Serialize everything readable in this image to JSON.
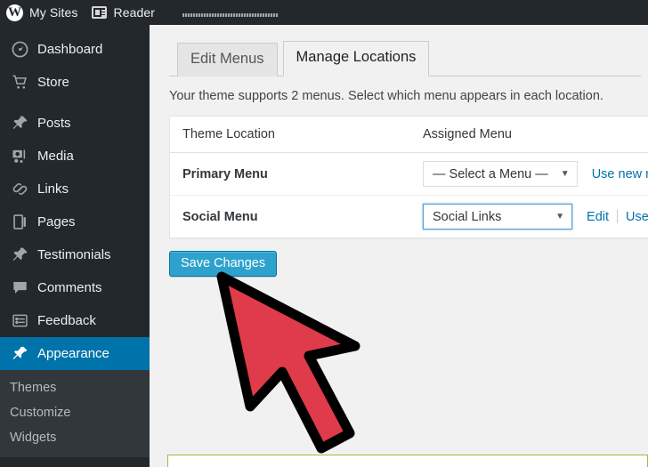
{
  "adminbar": {
    "logo_icon": "wordpress-logo-icon",
    "items": [
      {
        "icon": "wordpress-logo-icon",
        "label": "My Sites"
      },
      {
        "icon": "reader-icon",
        "label": "Reader"
      }
    ],
    "redacted_icon": "redacted-bar"
  },
  "sidebar": {
    "items": [
      {
        "label": "Dashboard",
        "icon": "dashboard-icon",
        "current": false
      },
      {
        "label": "Store",
        "icon": "cart-icon",
        "current": false
      },
      {
        "label": "Posts",
        "icon": "pin-icon",
        "current": false
      },
      {
        "label": "Media",
        "icon": "camera-icon",
        "current": false
      },
      {
        "label": "Links",
        "icon": "link-icon",
        "current": false
      },
      {
        "label": "Pages",
        "icon": "page-icon",
        "current": false
      },
      {
        "label": "Testimonials",
        "icon": "pin-icon",
        "current": false
      },
      {
        "label": "Comments",
        "icon": "comment-icon",
        "current": false
      },
      {
        "label": "Feedback",
        "icon": "feedback-icon",
        "current": false
      },
      {
        "label": "Appearance",
        "icon": "brush-icon",
        "current": true
      }
    ],
    "submenu": [
      {
        "label": "Themes"
      },
      {
        "label": "Customize"
      },
      {
        "label": "Widgets"
      }
    ],
    "colors": {
      "background": "#23282d",
      "submenu_background": "#32373c",
      "current_background": "#0073aa"
    }
  },
  "tabs": [
    {
      "label": "Edit Menus",
      "active": false
    },
    {
      "label": "Manage Locations",
      "active": true
    }
  ],
  "main": {
    "description": "Your theme supports 2 menus. Select which menu appears in each location.",
    "table": {
      "headers": [
        "Theme Location",
        "Assigned Menu"
      ],
      "rows": [
        {
          "location": "Primary Menu",
          "selected_menu": "— Select a Menu —",
          "focused": false,
          "links": [
            "Use new menu"
          ],
          "show_edit": false
        },
        {
          "location": "Social Menu",
          "selected_menu": "Social Links",
          "focused": true,
          "links": [
            "Use new menu"
          ],
          "show_edit": true,
          "edit_label": "Edit"
        }
      ]
    },
    "save_label": "Save Changes",
    "caret_glyph": "▼"
  },
  "colors": {
    "accent": "#0073aa",
    "button": "#2ea2cc",
    "link": "#0073aa",
    "cursor_fill": "#e03b4b",
    "cursor_stroke": "#000000",
    "bottom_box_border": "#a3b745"
  },
  "cursor": {
    "icon": "mouse-pointer-icon"
  }
}
